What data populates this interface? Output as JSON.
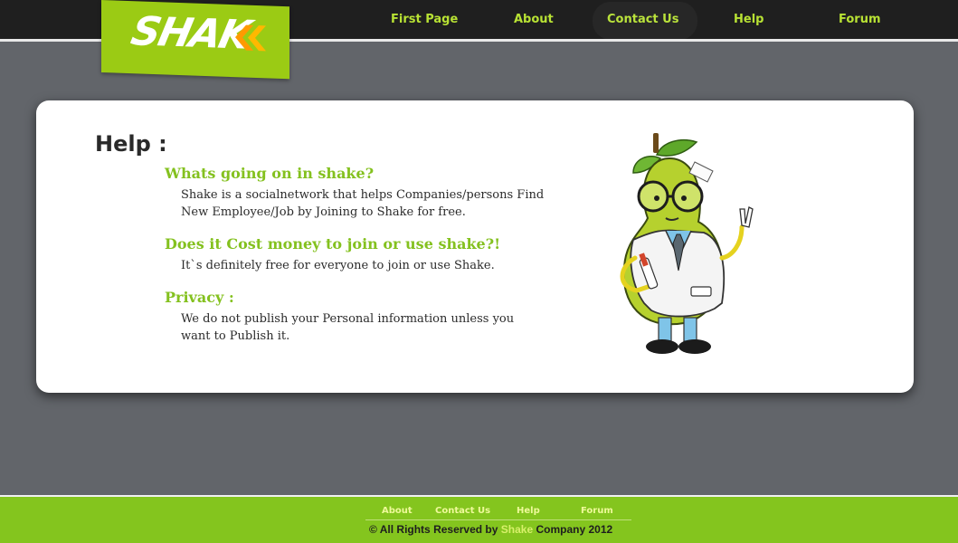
{
  "logo": {
    "text": "SHAK"
  },
  "nav": [
    {
      "label": "First Page"
    },
    {
      "label": "About"
    },
    {
      "label": "Contact Us"
    },
    {
      "label": "Help"
    },
    {
      "label": "Forum"
    }
  ],
  "page": {
    "title": "Help :",
    "faqs": [
      {
        "question": "Whats going on in shake?",
        "answer": "Shake is a socialnetwork that helps Companies/persons Find New Employee/Job by Joining to Shake for free."
      },
      {
        "question": "Does it Cost money to join or use shake?!",
        "answer": "It`s definitely free for everyone to join or use Shake."
      },
      {
        "question": "Privacy :",
        "answer": "We do not publish your Personal information unless you want to Publish it."
      }
    ]
  },
  "footer": {
    "links": [
      {
        "label": "About"
      },
      {
        "label": "Contact Us"
      },
      {
        "label": "Help"
      },
      {
        "label": "Forum"
      }
    ],
    "copyright_prefix": "© All Rights Reserved by",
    "copyright_brand": "Shake",
    "copyright_suffix": "Company 2012"
  },
  "colors": {
    "accent": "#84c51e",
    "header": "#1f1f1f",
    "background": "#62656a",
    "nav_text": "#b8e234"
  },
  "icons": {
    "logo_chevron": "double-chevron-right-icon",
    "mascot": "pear-doctor-mascot"
  }
}
